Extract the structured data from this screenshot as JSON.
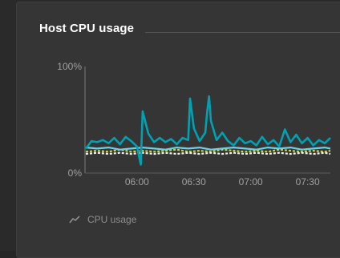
{
  "tile": {
    "title": "Host CPU usage"
  },
  "chart_data": {
    "type": "line",
    "ylim": [
      0,
      100
    ],
    "y_ticks": [
      "100%",
      "0%"
    ],
    "x_ticks": [
      "06:00",
      "06:30",
      "07:00",
      "07:30"
    ],
    "x_tick_values": [
      360,
      390,
      420,
      450
    ],
    "xlim": [
      333,
      462
    ],
    "grid": false,
    "series": [
      {
        "name": "CPU usage",
        "color": "#00a1b2",
        "x": [
          333,
          336,
          339,
          342,
          345,
          348,
          351,
          354,
          357,
          360,
          362,
          363,
          366,
          369,
          372,
          375,
          378,
          381,
          384,
          387,
          388,
          390,
          393,
          396,
          397,
          398,
          399,
          402,
          405,
          408,
          411,
          414,
          417,
          420,
          423,
          426,
          429,
          432,
          435,
          438,
          441,
          444,
          447,
          450,
          453,
          456,
          459,
          462
        ],
        "values": [
          23,
          30,
          29,
          31,
          28,
          33,
          27,
          34,
          30,
          25,
          8,
          58,
          37,
          29,
          33,
          29,
          32,
          27,
          33,
          31,
          70,
          42,
          30,
          38,
          57,
          72,
          49,
          31,
          38,
          30,
          26,
          33,
          28,
          30,
          26,
          34,
          27,
          31,
          25,
          41,
          29,
          36,
          28,
          33,
          26,
          31,
          28,
          33
        ]
      },
      {
        "name": "",
        "color": "#c8d84a",
        "x": [
          333,
          339,
          345,
          351,
          357,
          363,
          369,
          375,
          381,
          387,
          393,
          399,
          405,
          411,
          417,
          423,
          429,
          435,
          441,
          447,
          453,
          459,
          462
        ],
        "values": [
          20,
          21,
          20,
          22,
          20,
          21,
          20,
          21,
          22,
          20,
          21,
          20,
          22,
          21,
          20,
          21,
          20,
          22,
          21,
          20,
          21,
          20,
          21
        ]
      },
      {
        "name": "",
        "color": "#f3f3f3",
        "x": [
          333,
          339,
          345,
          351,
          357,
          363,
          369,
          375,
          381,
          387,
          393,
          399,
          405,
          411,
          417,
          423,
          429,
          435,
          441,
          447,
          453,
          459,
          462
        ],
        "values": [
          18,
          19,
          18,
          19,
          18,
          19,
          18,
          19,
          18,
          19,
          18,
          19,
          18,
          19,
          18,
          19,
          18,
          19,
          18,
          19,
          18,
          19,
          18
        ]
      },
      {
        "name": "",
        "color": "#6ed0e0",
        "x": [
          333,
          339,
          345,
          351,
          357,
          363,
          369,
          375,
          381,
          387,
          393,
          399,
          405,
          411,
          417,
          423,
          429,
          435,
          441,
          447,
          453,
          459,
          462
        ],
        "values": [
          24,
          23,
          24,
          22,
          23,
          24,
          23,
          22,
          24,
          23,
          24,
          22,
          23,
          24,
          23,
          22,
          24,
          23,
          24,
          22,
          23,
          24,
          23
        ]
      }
    ]
  },
  "legend": {
    "icon": "line-chart-icon",
    "label": "CPU usage"
  }
}
